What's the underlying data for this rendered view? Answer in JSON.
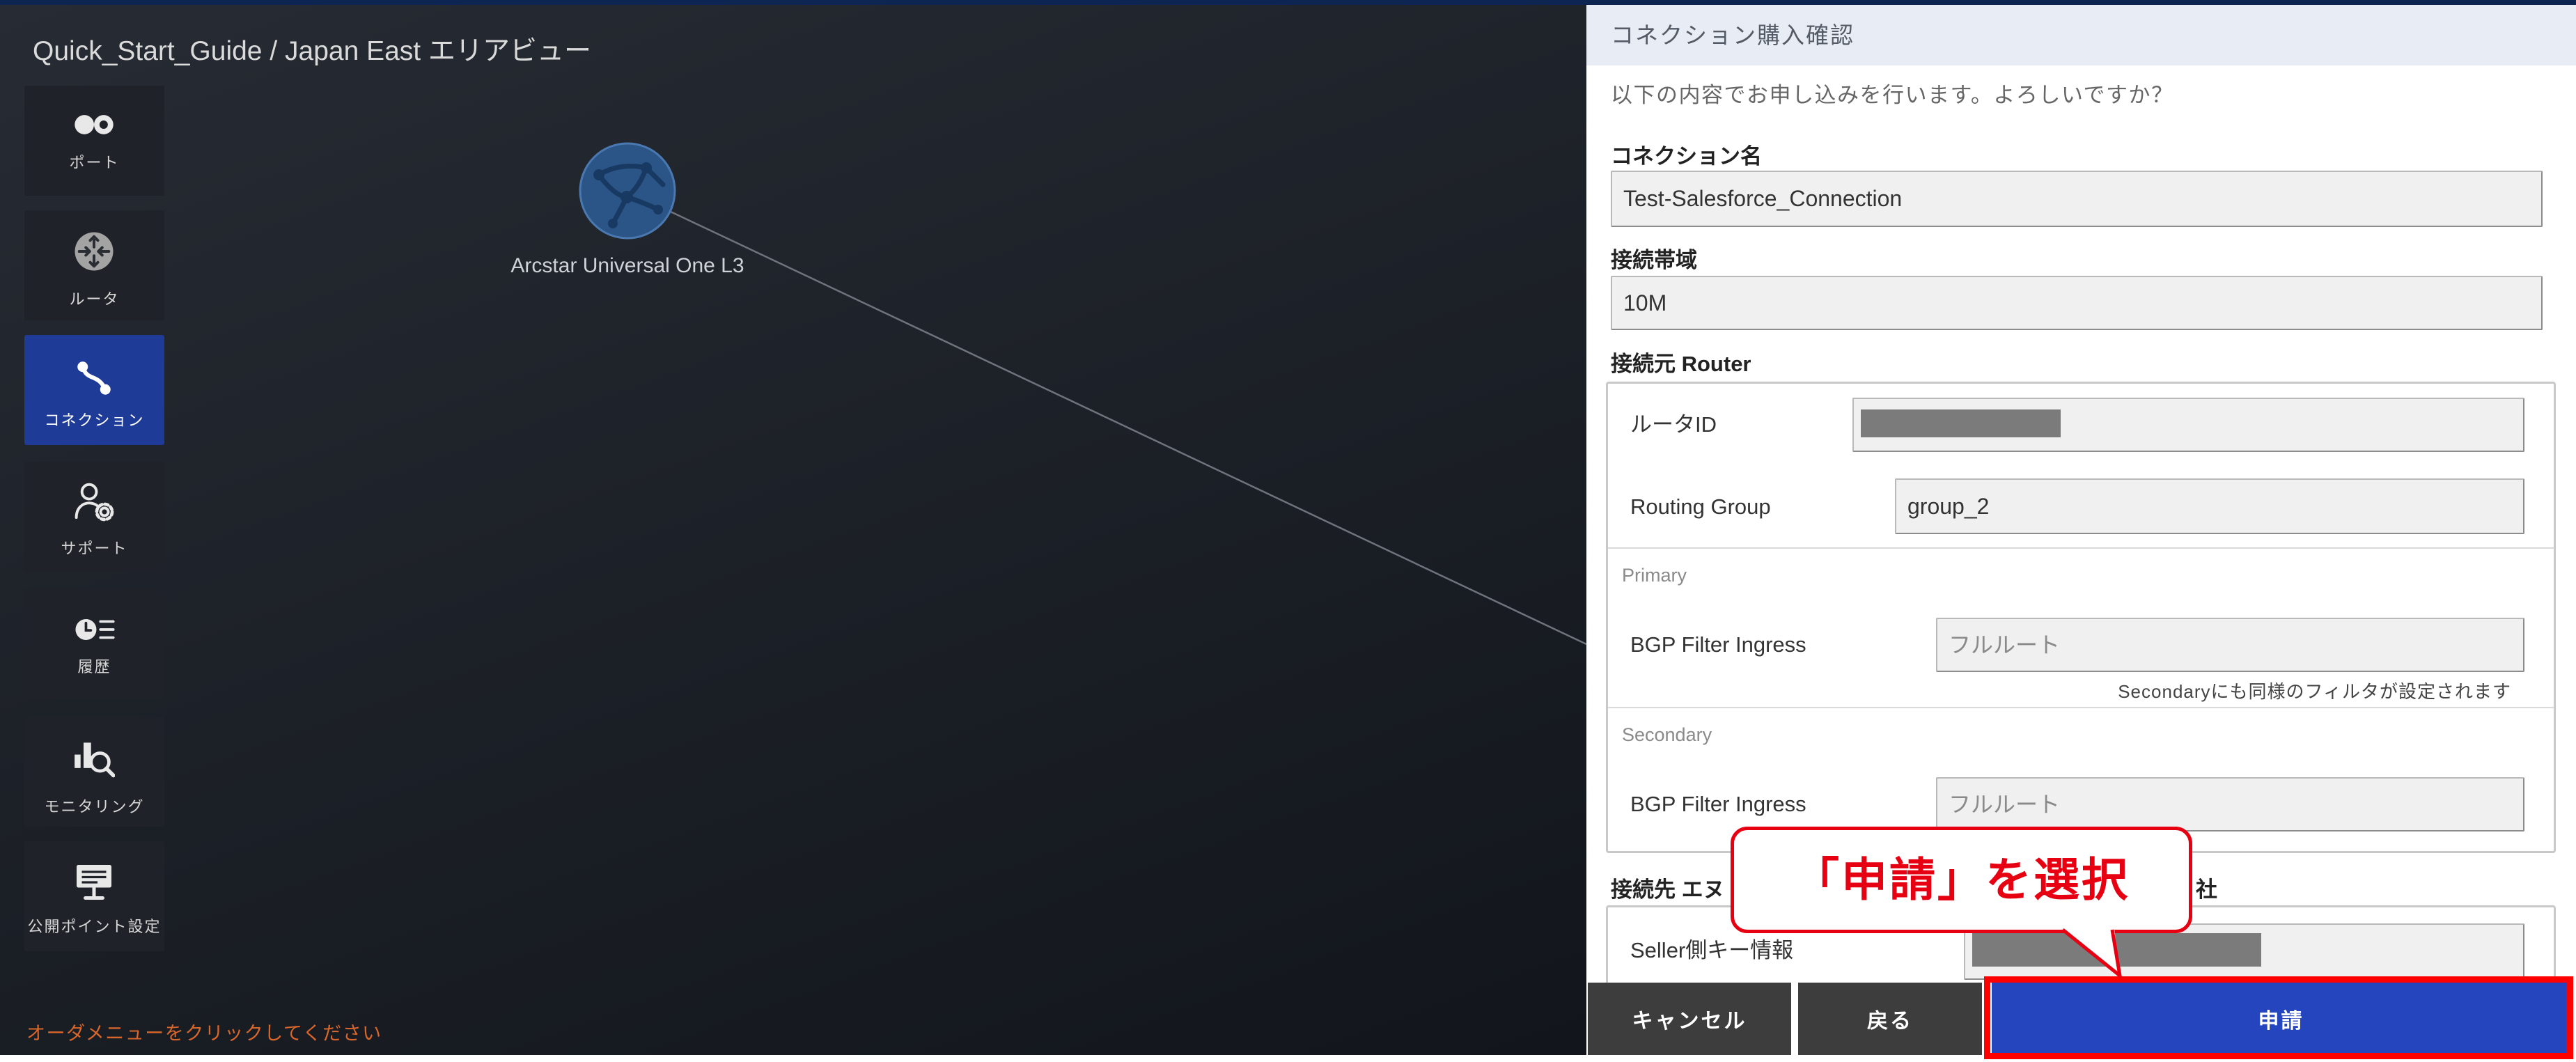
{
  "header": {
    "breadcrumb": "Quick_Start_Guide / Japan East エリアビュー"
  },
  "sidebar": {
    "items": [
      {
        "label": "ポート",
        "icon": "port-icon",
        "active": false
      },
      {
        "label": "ルータ",
        "icon": "router-icon",
        "active": false
      },
      {
        "label": "コネクション",
        "icon": "connection-icon",
        "active": true
      },
      {
        "label": "サポート",
        "icon": "support-icon",
        "active": false
      },
      {
        "label": "履歴",
        "icon": "history-icon",
        "active": false
      },
      {
        "label": "モニタリング",
        "icon": "monitoring-icon",
        "active": false
      },
      {
        "label": "公開ポイント設定",
        "icon": "public-point-settings-icon",
        "active": false
      }
    ]
  },
  "canvas": {
    "node": {
      "label": "Arcstar Universal One L3",
      "icon": "network-globe-icon"
    },
    "hint": "オーダメニューをクリックしてください"
  },
  "dialog": {
    "title": "コネクション購入確認",
    "message": "以下の内容でお申し込みを行います。よろしいですか？",
    "connection_name": {
      "label": "コネクション名",
      "value": "Test-Salesforce_Connection"
    },
    "bandwidth": {
      "label": "接続帯域",
      "value": "10M"
    },
    "source": {
      "label": "接続元 Router",
      "router_id": {
        "label": "ルータID"
      },
      "routing_group": {
        "label": "Routing Group",
        "value": "group_2"
      },
      "primary": {
        "heading": "Primary",
        "bgp_filter_label": "BGP Filter Ingress",
        "bgp_filter_placeholder": "フルルート",
        "note": "Secondaryにも同様のフィルタが設定されます"
      },
      "secondary": {
        "heading": "Secondary",
        "bgp_filter_label": "BGP Filter Ingress",
        "bgp_filter_placeholder": "フルルート"
      }
    },
    "destination": {
      "label_visible_start": "接続先 エヌ",
      "label_visible_end": "社",
      "seller_key": {
        "label": "Seller側キー情報"
      }
    },
    "buttons": {
      "cancel": "キャンセル",
      "back": "戻る",
      "submit": "申請"
    }
  },
  "annotation": {
    "callout_text": "「申請」を選択"
  },
  "colors": {
    "canvas_top": "#272b33",
    "canvas_bottom": "#12161c",
    "nav_bg": "#1f2228",
    "nav_active": "#1e3b98",
    "submit": "#2445bd",
    "secondary_btn": "#3d3d3d",
    "highlight": "#ff0000",
    "hint": "#d9662a",
    "callout": "#e60012"
  }
}
